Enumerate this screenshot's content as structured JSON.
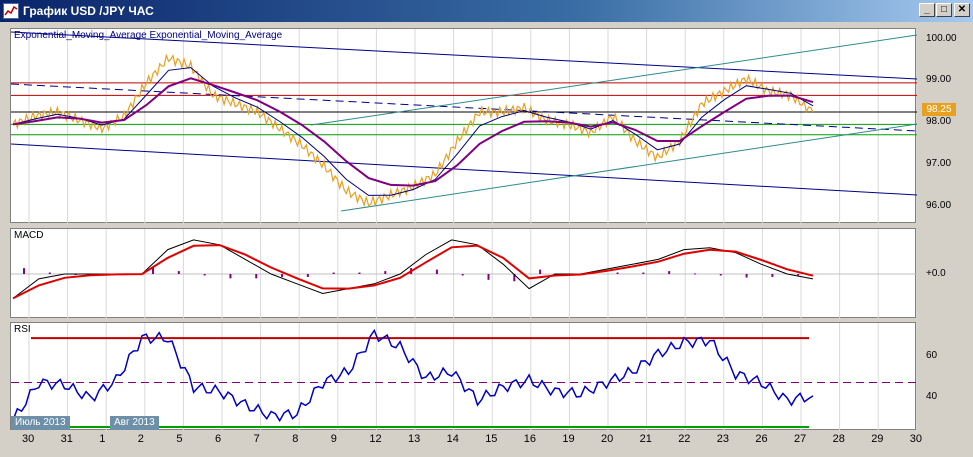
{
  "window": {
    "title": "График USD /JPY ЧАС",
    "minimize": "_",
    "maximize": "□",
    "close": "✕"
  },
  "price": {
    "indicator_label": "Exponential_Moving_Average Exponential_Moving_Average",
    "current_value": "98.25",
    "y_ticks": [
      "100.00",
      "99.00",
      "98.00",
      "97.00",
      "96.00"
    ]
  },
  "macd": {
    "label": "MACD",
    "y_ticks": [
      "+0.0"
    ]
  },
  "rsi": {
    "label": "RSI",
    "y_ticks": [
      "60",
      "40"
    ]
  },
  "time_axis": {
    "month_labels": [
      "Июль 2013",
      "Авг 2013"
    ],
    "days": [
      "30",
      "31",
      "1",
      "2",
      "5",
      "6",
      "7",
      "8",
      "9",
      "12",
      "13",
      "14",
      "15",
      "16",
      "19",
      "20",
      "21",
      "22",
      "23",
      "26",
      "27",
      "28",
      "29",
      "30"
    ]
  },
  "colors": {
    "price": "#e8a020",
    "ema_slow": "#800080",
    "ema_fast": "#000080",
    "macd_signal": "#e00000",
    "rsi_line": "#0000c0",
    "resistance": "#c00000",
    "support": "#00a000"
  },
  "chart_data": [
    {
      "type": "line",
      "title": "",
      "series": [
        {
          "name": "",
          "values": [
            98.0,
            98.2,
            98.3,
            98.1,
            97.9,
            98.2,
            99.0,
            99.6,
            99.4,
            98.7,
            98.5,
            98.3,
            97.9,
            97.5,
            97.0,
            96.4,
            96.1,
            96.3,
            96.5,
            96.8,
            97.6,
            98.3,
            98.3,
            98.4,
            98.1,
            98.0,
            97.8,
            98.2,
            97.6,
            97.2,
            97.6,
            98.5,
            98.8,
            99.1,
            98.8,
            98.7,
            98.3
          ]
        }
      ],
      "ylim": [
        95.7,
        100.2
      ]
    },
    {
      "type": "line",
      "title": "",
      "series": [
        {
          "name": "",
          "values": [
            -0.25,
            -0.05,
            0.0,
            0.0,
            0.0,
            0.0,
            0.25,
            0.35,
            0.3,
            0.15,
            0.0,
            -0.1,
            -0.2,
            -0.15,
            -0.1,
            0.0,
            0.2,
            0.35,
            0.3,
            0.1,
            -0.15,
            0.0,
            0.0,
            0.05,
            0.1,
            0.15,
            0.25,
            0.27,
            0.22,
            0.1,
            0.0,
            -0.05
          ]
        }
      ],
      "ylim": [
        -0.4,
        0.4
      ]
    },
    {
      "type": "line",
      "title": "",
      "series": [
        {
          "name": "",
          "values": [
            33,
            50,
            49,
            43,
            51,
            70,
            70,
            48,
            46,
            40,
            35,
            36,
            50,
            55,
            72,
            66,
            52,
            55,
            42,
            48,
            51,
            46,
            45,
            50,
            55,
            63,
            68,
            69,
            54,
            50,
            42,
            44
          ]
        }
      ],
      "ylim": [
        30,
        75
      ]
    }
  ]
}
